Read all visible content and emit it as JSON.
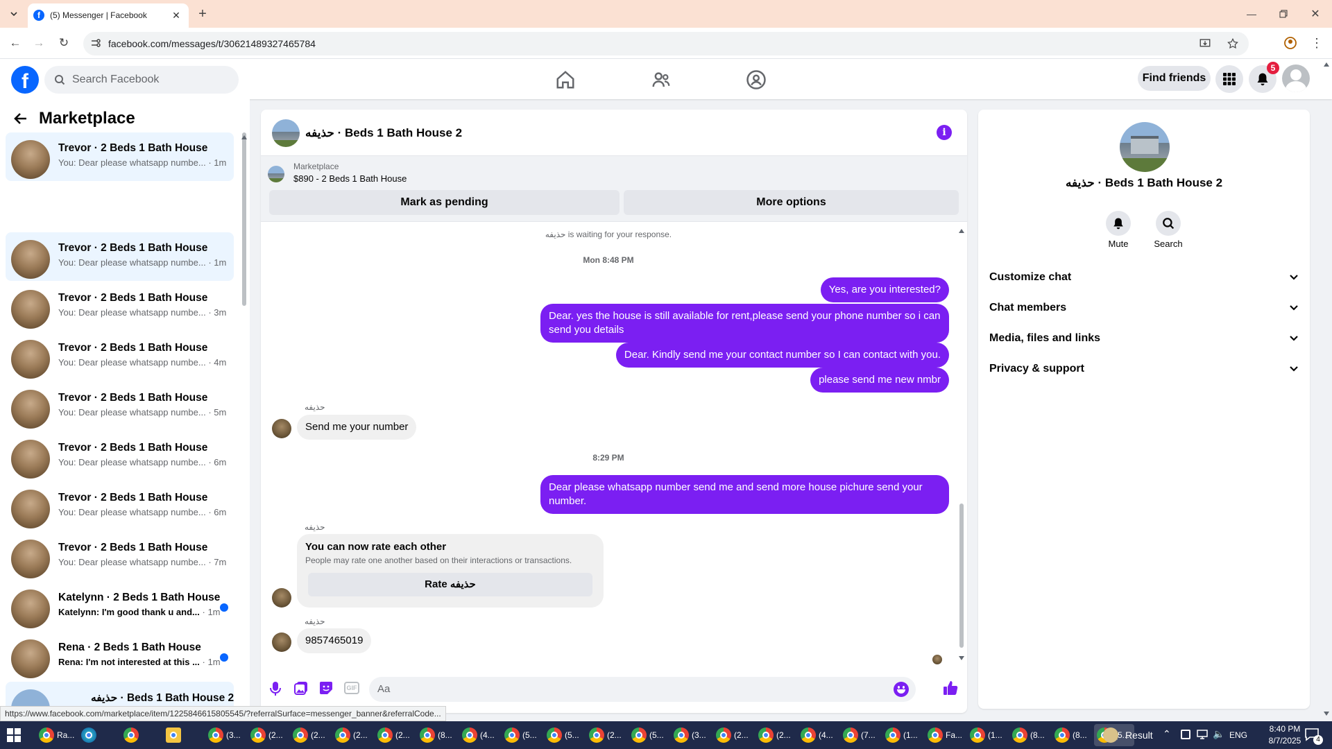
{
  "browser": {
    "tab_title": "(5) Messenger | Facebook",
    "url": "facebook.com/messages/t/30621489327465784",
    "status_url": "https://www.facebook.com/marketplace/item/1225846615805545/?referralSurface=messenger_banner&referralCode..."
  },
  "fb": {
    "search_placeholder": "Search Facebook",
    "find_friends": "Find friends",
    "notif_count": "5"
  },
  "left": {
    "title": "Marketplace",
    "conversations": [
      {
        "title": "Trevor · 2 Beds 1 Bath House",
        "snippet": "You: Dear please whatsapp numbe...",
        "time": "· 1m"
      },
      {
        "title": "Trevor · 2 Beds 1 Bath House",
        "snippet": "You: Dear please whatsapp numbe...",
        "time": "· 1m"
      },
      {
        "title": "Trevor · 2 Beds 1 Bath House",
        "snippet": "You: Dear please whatsapp numbe...",
        "time": "· 3m"
      },
      {
        "title": "Trevor · 2 Beds 1 Bath House",
        "snippet": "You: Dear please whatsapp numbe...",
        "time": "· 4m"
      },
      {
        "title": "Trevor · 2 Beds 1 Bath House",
        "snippet": "You: Dear please whatsapp numbe...",
        "time": "· 5m"
      },
      {
        "title": "Trevor · 2 Beds 1 Bath House",
        "snippet": "You: Dear please whatsapp numbe...",
        "time": "· 6m"
      },
      {
        "title": "Trevor · 2 Beds 1 Bath House",
        "snippet": "You: Dear please whatsapp numbe...",
        "time": "· 6m"
      },
      {
        "title": "Trevor · 2 Beds 1 Bath House",
        "snippet": "You: Dear please whatsapp numbe...",
        "time": "· 7m"
      },
      {
        "title": "Katelynn · 2 Beds 1 Bath House",
        "snippet": "Katelynn: I'm good thank u and...",
        "time": "· 1m"
      },
      {
        "title": "Rena · 2 Beds 1 Bath House",
        "snippet": "Rena: I'm not interested at this ...",
        "time": "· 1m"
      },
      {
        "title": "حذيفه · Beds 1 Bath House 2",
        "snippet": "",
        "time": ""
      }
    ]
  },
  "chat": {
    "title": "حذيفه · Beds 1 Bath House 2",
    "banner_label": "Marketplace",
    "banner_listing": "$890 - 2 Beds 1 Bath House",
    "mark_pending": "Mark as pending",
    "more_options": "More options",
    "waiting": "حذيفه is waiting for your response.",
    "ts1": "Mon 8:48 PM",
    "out1": "Yes, are you interested?",
    "out2": "Dear. yes the house is still available for rent,please send your  phone number so i can send you details",
    "out3": "Dear. Kindly send me your contact number so I can contact with you.",
    "out4": "please send me new nmbr",
    "sender": "حذيفه",
    "in1": "Send me your number",
    "ts2": "8:29 PM",
    "out5": "Dear please whatsapp number send me and send more house pichure send your number.",
    "rate_title": "You can now rate each other",
    "rate_sub": "People may rate one another based on their interactions or transactions.",
    "rate_btn": "Rate حذيفه",
    "in2": "9857465019",
    "composer_placeholder": "Aa"
  },
  "right": {
    "name": "حذيفه · Beds 1 Bath House 2",
    "mute": "Mute",
    "search": "Search",
    "rows": [
      "Customize chat",
      "Chat members",
      "Media, files and links",
      "Privacy & support"
    ]
  },
  "taskbar": {
    "apps": [
      "Ra...",
      "",
      "",
      "",
      "(3...",
      "(2...",
      "(2...",
      "(2...",
      "(2...",
      "(8...",
      "(4...",
      "(5...",
      "(5...",
      "(2...",
      "(5...",
      "(3...",
      "(2...",
      "(2...",
      "(4...",
      "(7...",
      "(1...",
      "Fa...",
      "(1...",
      "(8...",
      "(8...",
      "(5..."
    ],
    "result": "Result",
    "lang": "ENG",
    "time": "8:40 PM",
    "date": "8/7/2025",
    "notif": "4"
  },
  "colors": {
    "accent": "#7b1ff2",
    "fb_blue": "#0866ff",
    "notif_red": "#e41e3f"
  }
}
